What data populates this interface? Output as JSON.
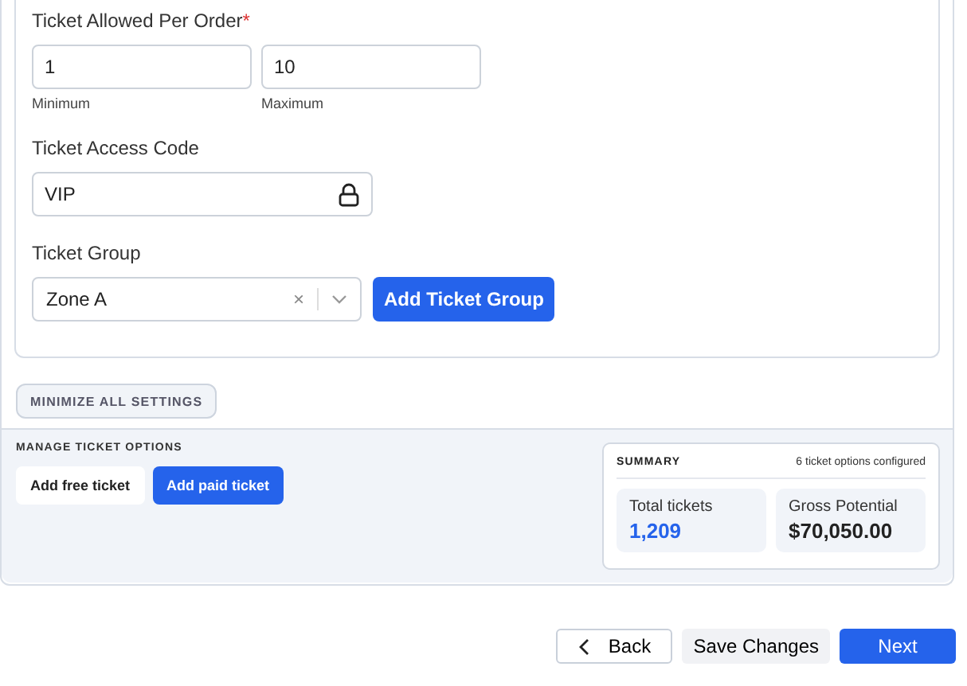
{
  "order_limit": {
    "label": "Ticket Allowed Per Order",
    "required_mark": "*",
    "min": {
      "value": "1",
      "helper": "Minimum"
    },
    "max": {
      "value": "10",
      "helper": "Maximum"
    }
  },
  "access_code": {
    "label": "Ticket Access Code",
    "value": "VIP"
  },
  "ticket_group": {
    "label": "Ticket Group",
    "value": "Zone A",
    "clear": "×",
    "add_button": "Add Ticket Group"
  },
  "minimize_button": "MINIMIZE ALL SETTINGS",
  "manage": {
    "title": "MANAGE TICKET OPTIONS",
    "buttons": [
      {
        "label": "Add free ticket",
        "kind": "secondary"
      },
      {
        "label": "Add paid ticket",
        "kind": "primary"
      }
    ]
  },
  "summary": {
    "title": "SUMMARY",
    "note": "6 ticket options configured",
    "stats": [
      {
        "label": "Total tickets",
        "value": "1,209",
        "kind": "accent"
      },
      {
        "label": "Gross Potential",
        "value": "$70,050.00",
        "kind": "plain"
      }
    ]
  },
  "footer": {
    "back": "Back",
    "save": "Save Changes",
    "next": "Next"
  }
}
